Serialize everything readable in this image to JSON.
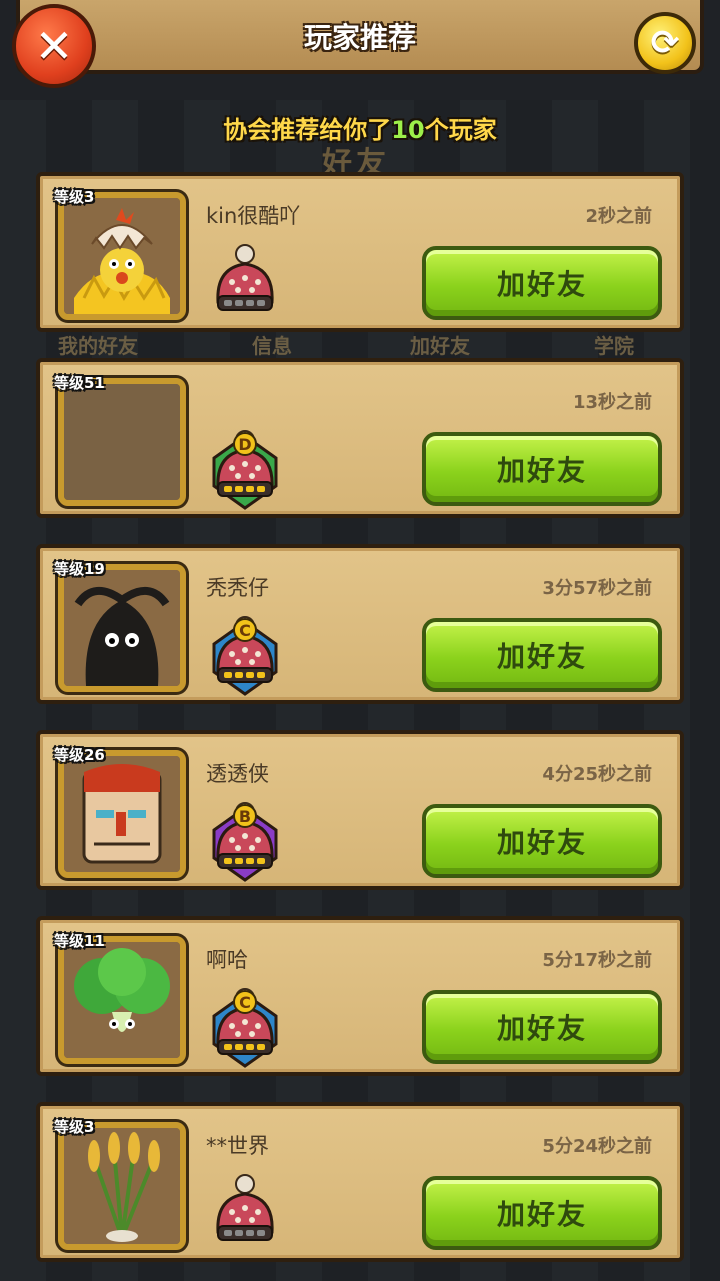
{
  "header": {
    "title": "玩家推荐",
    "close_label": "✕",
    "refresh_label": "⟳"
  },
  "recommend": {
    "prefix": "协会推荐给你了",
    "count": "10",
    "suffix": "个玩家"
  },
  "background": {
    "title": "好友",
    "tabs": [
      "我的好友",
      "信息",
      "加好友",
      "学院"
    ]
  },
  "players": [
    {
      "level": "等级3",
      "name": "kin很酷吖",
      "time": "2秒之前",
      "rank": "",
      "rank_color": "#d9d2c2",
      "avatar": "chick-in-eggshell"
    },
    {
      "level": "等级51",
      "name": "",
      "time": "13秒之前",
      "rank": "D",
      "rank_color": "#3aa84a",
      "avatar": "empty"
    },
    {
      "level": "等级19",
      "name": "秃秃仔",
      "time": "3分57秒之前",
      "rank": "C",
      "rank_color": "#2e86c9",
      "avatar": "dark-blob"
    },
    {
      "level": "等级26",
      "name": "透透侠",
      "time": "4分25秒之前",
      "rank": "B",
      "rank_color": "#8a3cc6",
      "avatar": "bandaged-head"
    },
    {
      "level": "等级11",
      "name": "啊哈",
      "time": "5分17秒之前",
      "rank": "C",
      "rank_color": "#2e86c9",
      "avatar": "lettuce"
    },
    {
      "level": "等级3",
      "name": "**世界",
      "time": "5分24秒之前",
      "rank": "",
      "rank_color": "#d9d2c2",
      "avatar": "wheat"
    }
  ],
  "add_friend_label": "加好友",
  "colors": {
    "button_green": "#8bd21c",
    "close_red": "#e0401e",
    "refresh_yellow": "#f2c21a",
    "card_tan": "#d6b577"
  }
}
